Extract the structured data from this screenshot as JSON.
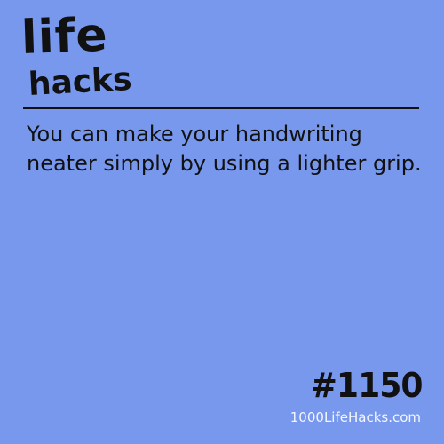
{
  "brand": {
    "logo_line1": "life",
    "logo_line2": "hacks"
  },
  "hack": {
    "text": "You can make your handwriting neater simply by using a lighter grip.",
    "number": "#1150"
  },
  "footer": {
    "site": "1000LifeHacks.com"
  },
  "colors": {
    "background": "#7898ee",
    "text": "#111111",
    "site_text": "#f4f6ff"
  }
}
